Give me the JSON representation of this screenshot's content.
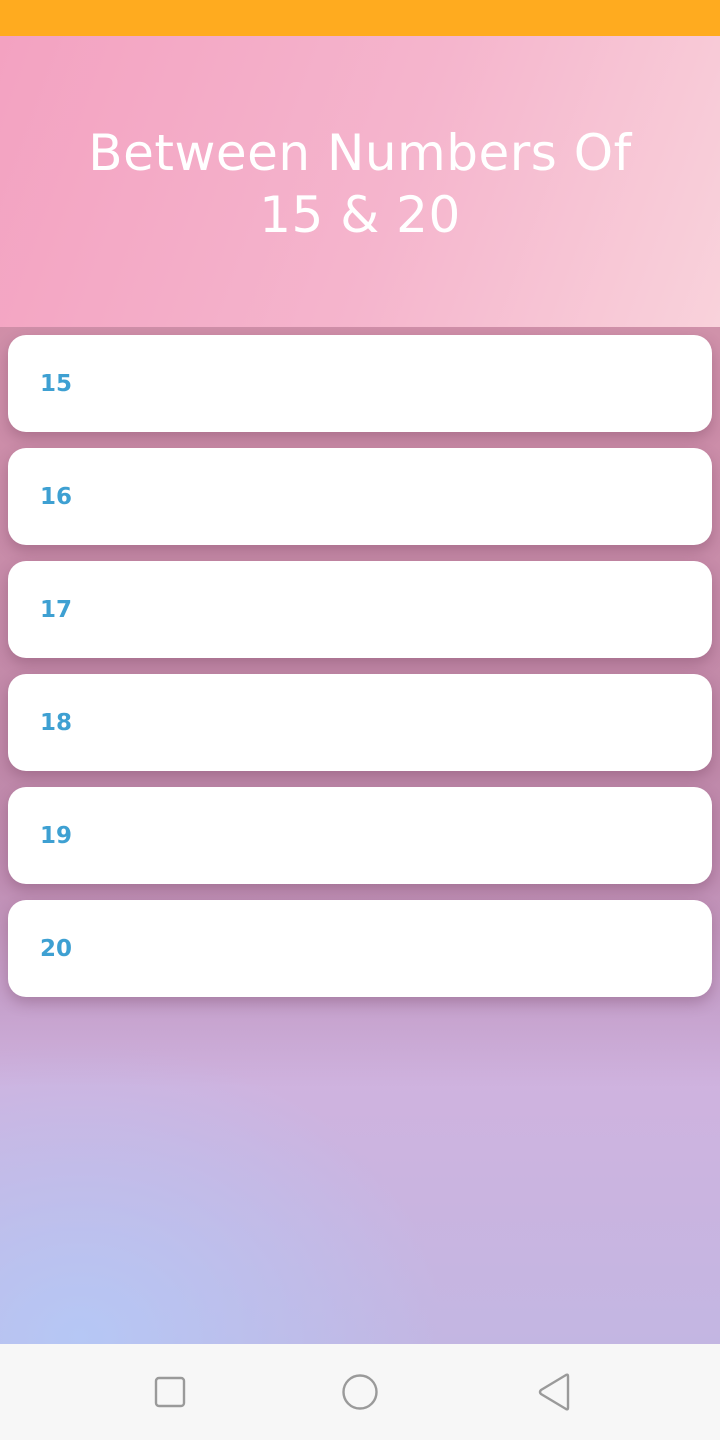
{
  "colors": {
    "status_bar": "#ffab1f",
    "item_text": "#3ea0d2",
    "title_text": "#ffffff",
    "nav_icon": "#9a9a9a"
  },
  "header": {
    "title_line1": "Between Numbers Of",
    "title_line2": "15 & 20"
  },
  "list": {
    "items": [
      {
        "label": "15"
      },
      {
        "label": "16"
      },
      {
        "label": "17"
      },
      {
        "label": "18"
      },
      {
        "label": "19"
      },
      {
        "label": "20"
      }
    ]
  },
  "nav": {
    "icons": [
      "recents-icon",
      "home-icon",
      "back-icon"
    ]
  }
}
